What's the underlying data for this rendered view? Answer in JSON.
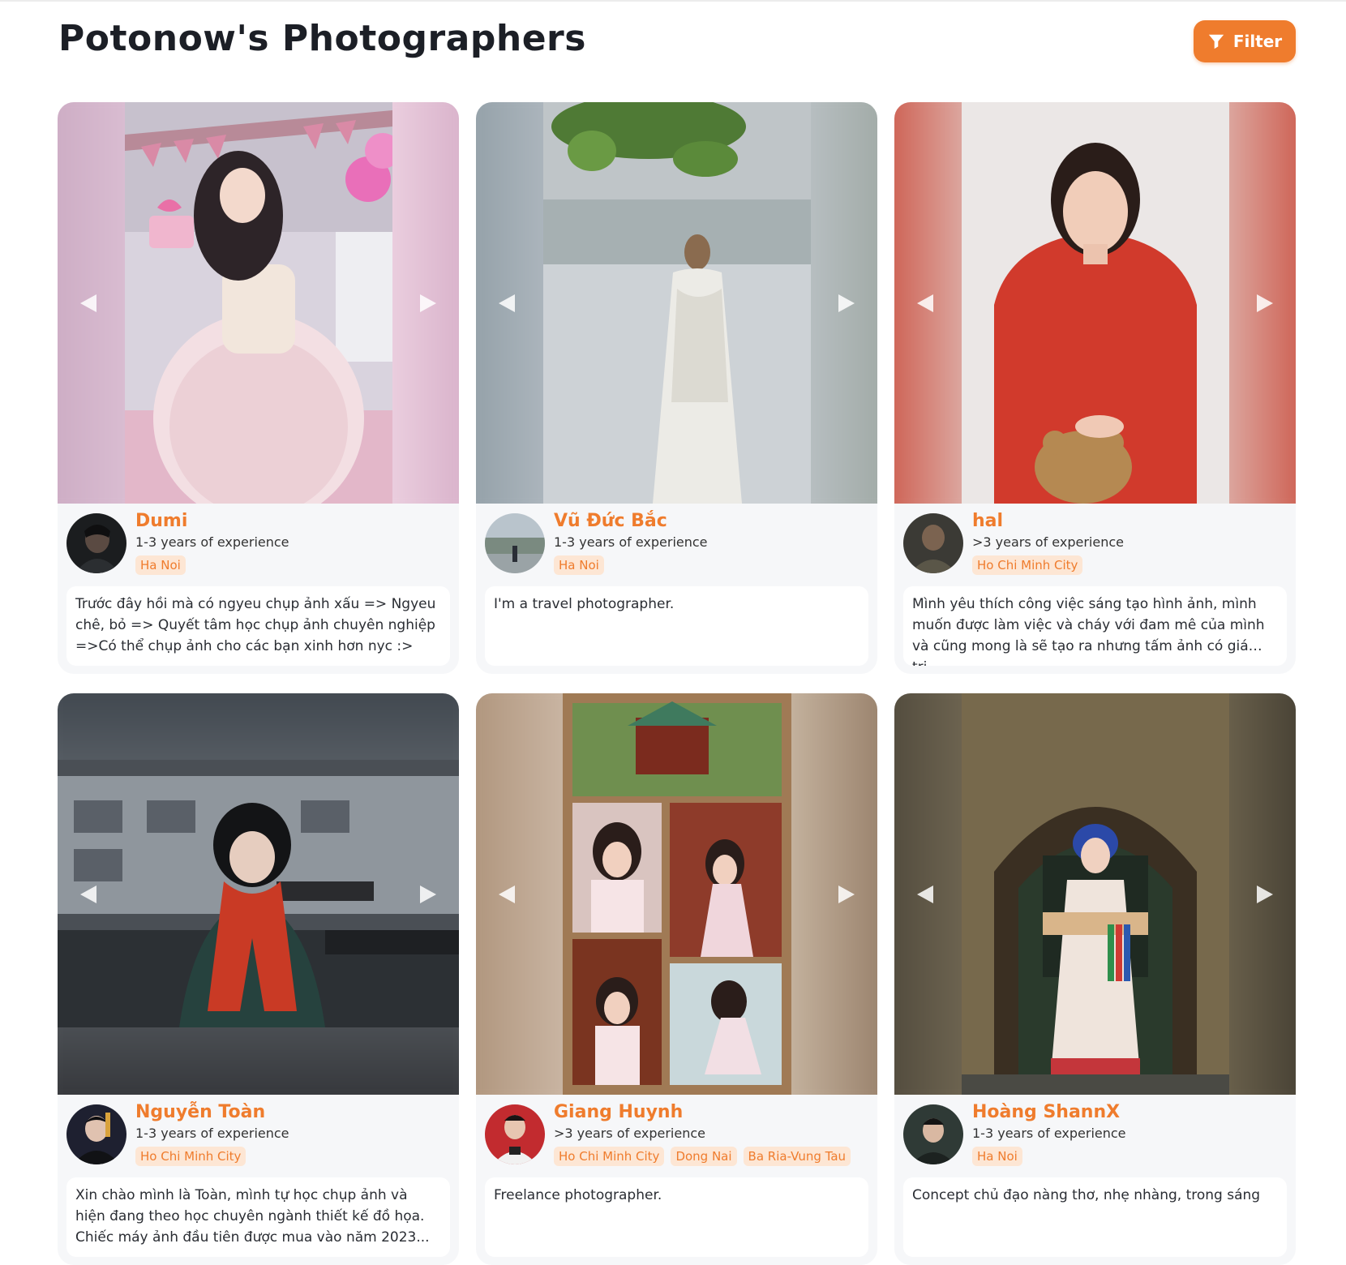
{
  "header": {
    "title": "Potonow's Photographers",
    "filter_label": "Filter"
  },
  "colors": {
    "accent": "#ef7c2d",
    "tag_bg": "#fde6d4",
    "card_bg": "#f6f7f9"
  },
  "photographers": [
    {
      "name": "Dumi",
      "experience": "1-3 years of experience",
      "locations": [
        "Ha Noi"
      ],
      "bio": "Trước đây hồi mà có ngyeu chụp ảnh xấu => Ngyeu chê, bỏ => Quyết tâm học chụp ảnh chuyên nghiệp =>Có thể chụp ảnh cho các bạn xinh hơn nyc :>"
    },
    {
      "name": "Vũ Đức Bắc",
      "experience": "1-3 years of experience",
      "locations": [
        "Ha Noi"
      ],
      "bio": "I'm a travel photographer."
    },
    {
      "name": "hal",
      "experience": ">3 years of experience",
      "locations": [
        "Ho Chi Minh City"
      ],
      "bio": "Mình yêu thích công việc sáng tạo hình ảnh, mình muốn được làm việc và cháy với đam mê của mình và cũng mong là sẽ tạo ra nhưng tấm ảnh có giá trị..."
    },
    {
      "name": "Nguyễn Toàn",
      "experience": "1-3 years of experience",
      "locations": [
        "Ho Chi Minh City"
      ],
      "bio": "Xin chào mình là Toàn, mình tự học chụp ảnh và hiện đang theo học chuyên ngành thiết kế đồ họa. Chiếc máy ảnh đầu tiên được mua vào năm 2023..."
    },
    {
      "name": "Giang Huynh",
      "experience": ">3 years of experience",
      "locations": [
        "Ho Chi Minh City",
        "Dong Nai",
        "Ba Ria-Vung Tau"
      ],
      "bio": "Freelance photographer."
    },
    {
      "name": "Hoàng ShannX",
      "experience": "1-3 years of experience",
      "locations": [
        "Ha Noi"
      ],
      "bio": "Concept chủ đạo nàng thơ, nhẹ nhàng, trong sáng"
    }
  ]
}
